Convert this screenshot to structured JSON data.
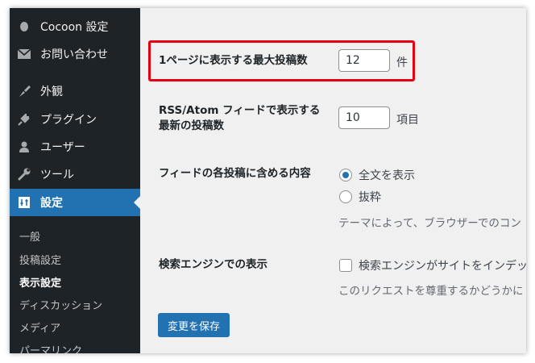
{
  "sidebar": {
    "items": [
      {
        "label": "Cocoon 設定",
        "icon": "cocoon-icon"
      },
      {
        "label": "お問い合わせ",
        "icon": "mail-icon"
      },
      {
        "label": "外観",
        "icon": "appearance-brush-icon"
      },
      {
        "label": "プラグイン",
        "icon": "plugin-icon"
      },
      {
        "label": "ユーザー",
        "icon": "user-icon"
      },
      {
        "label": "ツール",
        "icon": "wrench-icon"
      },
      {
        "label": "設定",
        "icon": "settings-icon",
        "active": true
      }
    ],
    "submenu": [
      {
        "label": "一般"
      },
      {
        "label": "投稿設定"
      },
      {
        "label": "表示設定",
        "current": true
      },
      {
        "label": "ディスカッション"
      },
      {
        "label": "メディア"
      },
      {
        "label": "パーマリンク"
      }
    ]
  },
  "settings": {
    "posts_per_page": {
      "label": "1ページに表示する最大投稿数",
      "value": "12",
      "unit": "件"
    },
    "posts_per_rss": {
      "label_line1": "RSS/Atom フィードで表示する",
      "label_line2": "最新の投稿数",
      "value": "10",
      "unit": "項目"
    },
    "rss_use_excerpt": {
      "label": "フィードの各投稿に含める内容",
      "options": [
        {
          "label": "全文を表示",
          "checked": true
        },
        {
          "label": "抜粋",
          "checked": false
        }
      ],
      "description": "テーマによって、ブラウザーでのコン"
    },
    "search_engine": {
      "label": "検索エンジンでの表示",
      "checkbox_label": "検索エンジンがサイトをインデッ",
      "checked": false,
      "description": "このリクエストを尊重するかどうかに"
    }
  },
  "save_button": "変更を保存",
  "colors": {
    "sidebar_bg": "#1d2327",
    "accent": "#2271b1",
    "highlight": "#e60012",
    "content_bg": "#f0f0f1"
  }
}
